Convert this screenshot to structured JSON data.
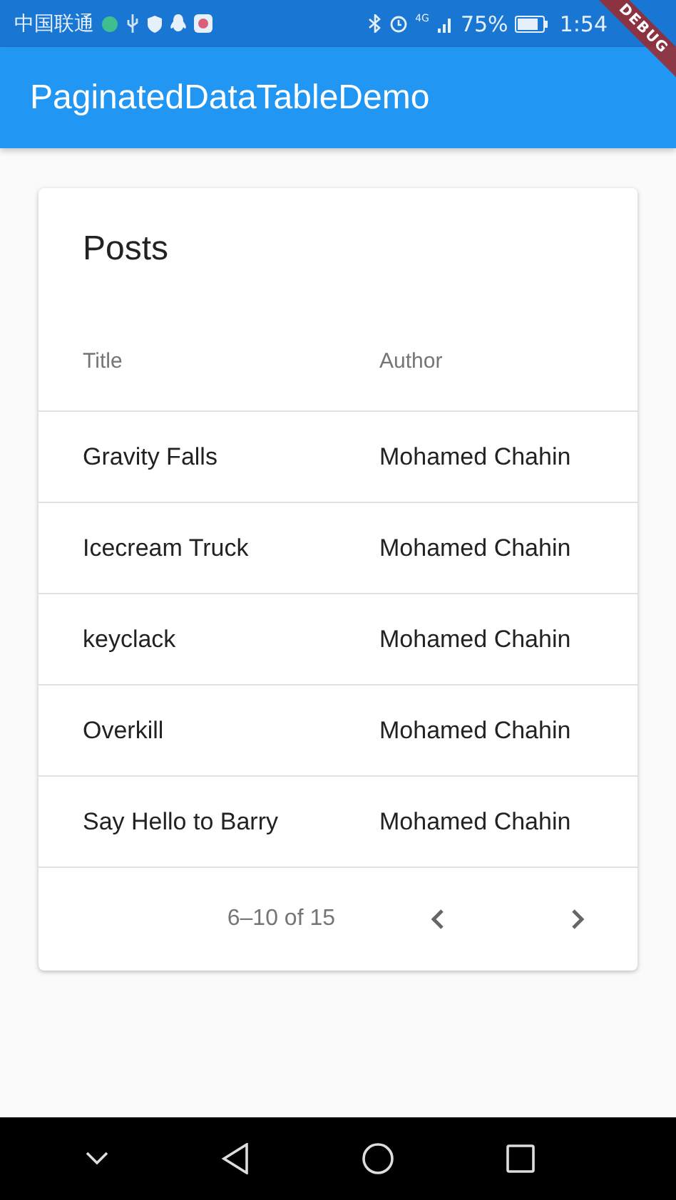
{
  "status_bar": {
    "carrier": "中国联通",
    "network": "4G",
    "battery": "75%",
    "time": "1:54"
  },
  "debug_banner": "DEBUG",
  "app_bar": {
    "title": "PaginatedDataTableDemo"
  },
  "table": {
    "title": "Posts",
    "columns": [
      "Title",
      "Author"
    ],
    "rows": [
      [
        "Gravity Falls",
        "Mohamed Chahin"
      ],
      [
        "Icecream Truck",
        "Mohamed Chahin"
      ],
      [
        "keyclack",
        "Mohamed Chahin"
      ],
      [
        "Overkill",
        "Mohamed Chahin"
      ],
      [
        "Say Hello to Barry",
        "Mohamed Chahin"
      ]
    ],
    "pagination": {
      "range": "6–10 of 15",
      "prev_disabled": false,
      "next_disabled": false
    }
  }
}
